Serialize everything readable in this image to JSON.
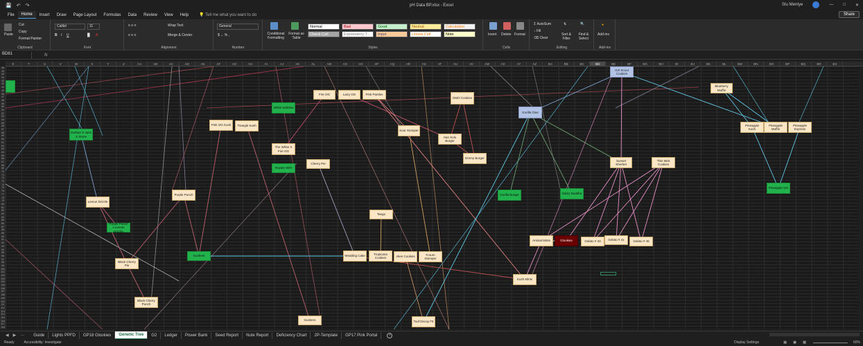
{
  "titlebar": {
    "title": "pH Data BP.xlsx  -  Excel",
    "user": "Stu Mentye",
    "autosave": "AutoSave"
  },
  "menu": {
    "items": [
      "File",
      "Home",
      "Insert",
      "Draw",
      "Page Layout",
      "Formulas",
      "Data",
      "Review",
      "View",
      "Help"
    ],
    "tellme": "Tell me what you want to do",
    "share": "Share"
  },
  "ribbon": {
    "clipboard": {
      "paste": "Paste",
      "cut": "Cut",
      "copy": "Copy",
      "painter": "Format Painter",
      "label": "Clipboard"
    },
    "font": {
      "name": "Calibri",
      "size": "11",
      "label": "Font"
    },
    "alignment": {
      "wrap": "Wrap Text",
      "merge": "Merge & Center",
      "label": "Alignment"
    },
    "number": {
      "format": "General",
      "label": "Number"
    },
    "styles": {
      "conditional": "Conditional Formatting",
      "format_table": "Format as Table",
      "cells": [
        {
          "text": "Normal",
          "bg": "#ffffff",
          "fg": "#000000"
        },
        {
          "text": "Bad",
          "bg": "#ffc7ce",
          "fg": "#9c0006"
        },
        {
          "text": "Good",
          "bg": "#c6efce",
          "fg": "#006100"
        },
        {
          "text": "Neutral",
          "bg": "#ffeb9c",
          "fg": "#9c5700"
        },
        {
          "text": "Calculation",
          "bg": "#f2f2f2",
          "fg": "#fa7d00"
        },
        {
          "text": "Check Cell",
          "bg": "#a5a5a5",
          "fg": "#ffffff"
        },
        {
          "text": "Explanatory T...",
          "bg": "#ffffff",
          "fg": "#7f7f7f"
        },
        {
          "text": "Input",
          "bg": "#ffcc99",
          "fg": "#3f3f76"
        },
        {
          "text": "Linked Cell",
          "bg": "#ffffff",
          "fg": "#fa7d00"
        },
        {
          "text": "Note",
          "bg": "#ffffcc",
          "fg": "#000000"
        }
      ],
      "label": "Styles"
    },
    "cells": {
      "insert": "Insert",
      "delete": "Delete",
      "format": "Format",
      "label": "Cells"
    },
    "editing": {
      "autosum": "AutoSum",
      "fill": "Fill",
      "clear": "Clear",
      "sort": "Sort & Filter",
      "find": "Find & Select",
      "label": "Editing"
    },
    "addins": {
      "addins": "Add-ins",
      "label": "Add-ins"
    }
  },
  "formula_bar": {
    "name_box": "BD81",
    "fx": "fx",
    "content": ""
  },
  "columns": [
    "S",
    "T",
    "U",
    "V",
    "W",
    "X",
    "Y",
    "Z",
    "AA",
    "AB",
    "AC",
    "AD",
    "AE",
    "AF",
    "AG",
    "AH",
    "AI",
    "AJ",
    "AK",
    "AL",
    "AM",
    "AN",
    "AO",
    "AP",
    "AQ",
    "AR",
    "AS",
    "AT",
    "AU",
    "AV",
    "AW",
    "AX",
    "AY",
    "AZ",
    "BA",
    "BB",
    "BC",
    "BD",
    "BE",
    "BF",
    "BG",
    "BH",
    "BI",
    "BJ",
    "BK",
    "BL",
    "BM",
    "BN",
    "BO",
    "BP",
    "BQ",
    "BR",
    "BS"
  ],
  "selected_column": "BD",
  "rows_start": 38,
  "nodes": [
    {
      "id": "n0",
      "label": "Girl Scout Cookies",
      "style": "blue"
    },
    {
      "id": "n1",
      "label": "Blueberry Muffin",
      "style": "tan"
    },
    {
      "id": "n2",
      "label": "Fire OG",
      "style": "tan"
    },
    {
      "id": "n3",
      "label": "Larry OG",
      "style": "tan"
    },
    {
      "id": "n4",
      "label": "Pink Panties",
      "style": "tan"
    },
    {
      "id": "n5",
      "label": "GMO Cookies",
      "style": "tan"
    },
    {
      "id": "n6",
      "label": "White Widdow",
      "style": "green"
    },
    {
      "id": "n7",
      "label": "Gorilla Glue",
      "style": "blue"
    },
    {
      "id": "n8",
      "label": "Durban X Jack X Stone",
      "style": "green"
    },
    {
      "id": "n9",
      "label": "Pink OG Kush",
      "style": "tan"
    },
    {
      "id": "n10",
      "label": "Triangle Kush",
      "style": "tan"
    },
    {
      "id": "n11",
      "label": "Sour Stomper",
      "style": "tan"
    },
    {
      "id": "n12",
      "label": "Han Solo Burger",
      "style": "tan"
    },
    {
      "id": "n13",
      "label": "Pineapple Kush",
      "style": "tan"
    },
    {
      "id": "n14",
      "label": "Pineapple Muffin",
      "style": "tan"
    },
    {
      "id": "n15",
      "label": "Pineapple Express",
      "style": "tan"
    },
    {
      "id": "n16",
      "label": "The White X Fire OG",
      "style": "tan"
    },
    {
      "id": "n17",
      "label": "Donny Burger",
      "style": "tan"
    },
    {
      "id": "n18",
      "label": "Sunset Sherbet",
      "style": "tan"
    },
    {
      "id": "n19",
      "label": "Thin Mint Cookies",
      "style": "tan"
    },
    {
      "id": "n20",
      "label": "Cherry Pie",
      "style": "tan"
    },
    {
      "id": "n21",
      "label": "Royale WiFi",
      "style": "green"
    },
    {
      "id": "n22",
      "label": "Pineapple OG",
      "style": "green"
    },
    {
      "id": "n23",
      "label": "Gorilla Burger",
      "style": "green"
    },
    {
      "id": "n24",
      "label": "Sticky Buddha",
      "style": "green"
    },
    {
      "id": "n25",
      "label": "Purple Punch",
      "style": "tan"
    },
    {
      "id": "n26",
      "label": "Lemon Drizzle",
      "style": "tan"
    },
    {
      "id": "n27",
      "label": "Tango",
      "style": "tan"
    },
    {
      "id": "n28",
      "label": "Purple Punch x Lemon Drizzle",
      "style": "green"
    },
    {
      "id": "n29",
      "label": "Animal Mints",
      "style": "tan"
    },
    {
      "id": "n30",
      "label": "Glookies",
      "style": "dark"
    },
    {
      "id": "n31",
      "label": "Gelato # 33",
      "style": "tan"
    },
    {
      "id": "n32",
      "label": "Gelato # 41",
      "style": "tan"
    },
    {
      "id": "n33",
      "label": "Gelato # 45",
      "style": "tan"
    },
    {
      "id": "n34",
      "label": "Gushers",
      "style": "green"
    },
    {
      "id": "n35",
      "label": "Wedding Cake",
      "style": "tan"
    },
    {
      "id": "n36",
      "label": "Tropicana Cookies",
      "style": "tan"
    },
    {
      "id": "n37",
      "label": "Alien Cookies",
      "style": "tan"
    },
    {
      "id": "n38",
      "label": "Forum Stomper",
      "style": "tan"
    },
    {
      "id": "n39",
      "label": "Black Cherry Pie",
      "style": "tan"
    },
    {
      "id": "n40",
      "label": "Kush Mints",
      "style": "tan"
    },
    {
      "id": "n41",
      "label": "Black Cherry Punch",
      "style": "tan"
    },
    {
      "id": "n42",
      "label": "Gushers",
      "style": "tan"
    },
    {
      "id": "n43",
      "label": "Toof Decay F5",
      "style": "tan"
    },
    {
      "id": "n44",
      "label": "",
      "style": "green"
    }
  ],
  "sheets": [
    "Guide",
    "Lights PPFD",
    "GP18 Glookies",
    "Genetic Tree",
    "G2",
    "Ledger",
    "Power Bank",
    "Seed Report",
    "Nute Report",
    "Deficiency Chart",
    "2P-Template",
    "GP17 Pink Portal"
  ],
  "active_sheet": "Genetic Tree",
  "status": {
    "ready": "Ready",
    "accessibility": "Accessibility: Investigate",
    "display": "Display Settings",
    "zoom": "60%"
  }
}
